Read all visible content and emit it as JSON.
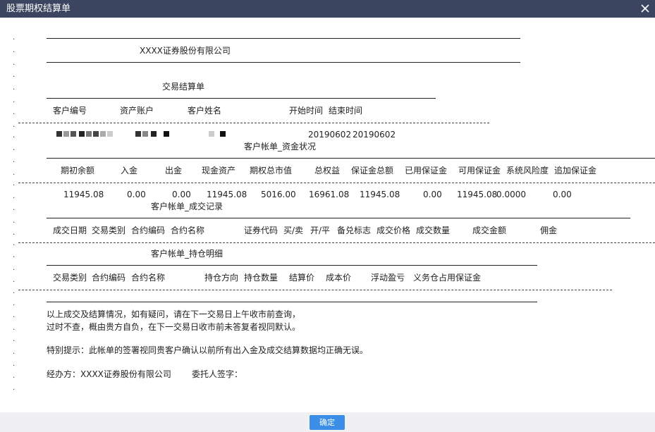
{
  "window": {
    "title": "股票期权结算单",
    "close_icon": "close-icon"
  },
  "statement": {
    "company_name": "XXXX证券股份有限公司",
    "statement_title": "交易结算单",
    "client_headers": [
      "客户编号",
      "资产账户",
      "客户姓名",
      "开始时间",
      "结束时间"
    ],
    "client_values": {
      "start_date": "20190602",
      "end_date": "20190602"
    },
    "funds_section": {
      "title": "客户帐单_资金状况",
      "headers": [
        "期初余额",
        "入金",
        "出金",
        "现金资产",
        "期权总市值",
        "总权益",
        "保证金总额",
        "已用保证金",
        "可用保证金",
        "系统风险度",
        "追加保证金"
      ],
      "values": [
        "11945.08",
        "0.00",
        "0.00",
        "11945.08",
        "5016.00",
        "16961.08",
        "11945.08",
        "0.00",
        "11945.08",
        "0.0000",
        "0.00"
      ]
    },
    "trades_section": {
      "title": "客户帐单_成交记录",
      "headers": [
        "成交日期",
        "交易类别",
        "合约编码",
        "合约名称",
        "证券代码",
        "买/卖",
        "开/平",
        "备兑标志",
        "成交价格",
        "成交数量",
        "成交金额",
        "佣金"
      ]
    },
    "positions_section": {
      "title": "客户帐单_持仓明细",
      "headers": [
        "交易类别",
        "合约编码",
        "合约名称",
        "持仓方向",
        "持仓数量",
        "结算价",
        "成本价",
        "浮动盈亏",
        "义务仓占用保证金"
      ]
    },
    "notes": [
      "以上成交及结算情况，如有疑问，请在下一交易日上午收市前查询，",
      "过时不查，概由贵方自负，在下一交易日收市前未答复者视同默认。"
    ],
    "special_notice": "特别提示：此帐单的签署视同贵客户确认以前所有出入金及成交结算数据均正确无误。",
    "handler_label": "经办方：XXXX证券股份有限公司",
    "signature_label": "委托人签字：",
    "margin_dots": [
      ".",
      ".",
      ".",
      ".",
      ".",
      ".",
      ".",
      ".",
      ".",
      ".",
      ".",
      ".",
      ".",
      ".",
      ".",
      ".",
      ".",
      ".",
      ".",
      ".",
      ".",
      ".",
      ".",
      ".",
      ".",
      ".",
      ".",
      ".",
      ".",
      "."
    ]
  },
  "footer": {
    "ok_label": "确定"
  }
}
